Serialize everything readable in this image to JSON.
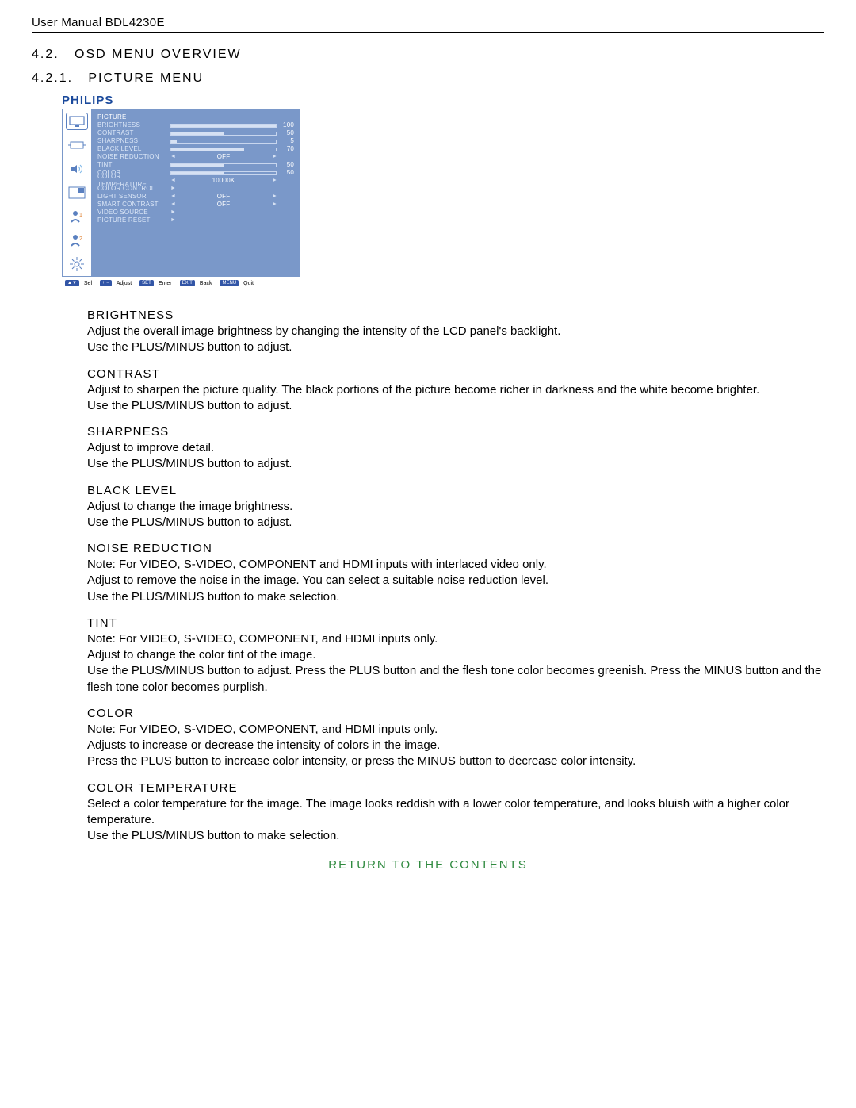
{
  "header": "User Manual BDL4230E",
  "section_no": "4.2.",
  "section_title": "OSD MENU OVERVIEW",
  "subsection_no": "4.2.1.",
  "subsection_title": "PICTURE MENU",
  "brand": "PHILIPS",
  "osd": {
    "menu_title": "PICTURE",
    "rows": [
      {
        "label": "BRIGHTNESS",
        "type": "slider",
        "value": 100,
        "max": 100
      },
      {
        "label": "CONTRAST",
        "type": "slider",
        "value": 50,
        "max": 100
      },
      {
        "label": "SHARPNESS",
        "type": "slider",
        "value": 5,
        "max": 100
      },
      {
        "label": "BLACK LEVEL",
        "type": "slider",
        "value": 70,
        "max": 100
      },
      {
        "label": "NOISE REDUCTION",
        "type": "option",
        "value": "OFF"
      },
      {
        "label": "TINT",
        "type": "slider",
        "value": 50,
        "max": 100
      },
      {
        "label": "COLOR",
        "type": "slider",
        "value": 50,
        "max": 100
      },
      {
        "label": "COLOR TEMPERATURE",
        "type": "option",
        "value": "10000K"
      },
      {
        "label": "COLOR CONTROL",
        "type": "enter",
        "value": ""
      },
      {
        "label": "LIGHT SENSOR",
        "type": "option",
        "value": "OFF"
      },
      {
        "label": "SMART CONTRAST",
        "type": "option",
        "value": "OFF"
      },
      {
        "label": "VIDEO SOURCE",
        "type": "enter",
        "value": ""
      },
      {
        "label": "PICTURE RESET",
        "type": "enter",
        "value": ""
      }
    ],
    "footer": {
      "sel": "Sel",
      "adjust": "Adjust",
      "enter_badge": "SET",
      "enter_lbl": "Enter",
      "back_badge": "EXIT",
      "back_lbl": "Back",
      "quit_badge": "MENU",
      "quit_lbl": "Quit"
    }
  },
  "items": [
    {
      "title": "BRIGHTNESS",
      "lines": [
        "Adjust the overall image brightness by changing the intensity of the LCD panel's backlight.",
        "Use the PLUS/MINUS button to adjust."
      ]
    },
    {
      "title": "CONTRAST",
      "lines": [
        "Adjust to sharpen the picture quality. The black portions of the picture become richer in darkness and the white become brighter.",
        "Use the PLUS/MINUS button to adjust."
      ]
    },
    {
      "title": "SHARPNESS",
      "lines": [
        "Adjust to improve detail.",
        "Use the PLUS/MINUS button to adjust."
      ]
    },
    {
      "title": "BLACK LEVEL",
      "lines": [
        "Adjust to change the image brightness.",
        "Use the PLUS/MINUS button to adjust."
      ]
    },
    {
      "title": "NOISE REDUCTION",
      "lines": [
        "Note: For VIDEO, S-VIDEO, COMPONENT and HDMI inputs with interlaced video only.",
        "Adjust to remove the noise in the image. You can select a suitable noise reduction level.",
        "Use the PLUS/MINUS button to make selection."
      ]
    },
    {
      "title": "TINT",
      "lines": [
        "Note: For VIDEO, S-VIDEO, COMPONENT, and HDMI inputs only.",
        "Adjust to change the color tint of the image.",
        "Use the PLUS/MINUS button to adjust. Press the PLUS button and the flesh tone color becomes greenish. Press the MINUS button and the flesh tone color becomes purplish."
      ]
    },
    {
      "title": "COLOR",
      "lines": [
        "Note: For VIDEO, S-VIDEO, COMPONENT, and HDMI inputs only.",
        "Adjusts to increase or decrease the intensity of colors in the image.",
        "Press the PLUS button to increase color intensity, or press the MINUS button to decrease color intensity."
      ]
    },
    {
      "title": "COLOR TEMPERATURE",
      "lines": [
        "Select a color temperature for the image. The image looks reddish with a lower color temperature, and looks bluish with a higher color temperature.",
        "Use the PLUS/MINUS button to make selection."
      ]
    }
  ],
  "return_link": "RETURN TO THE CONTENTS"
}
